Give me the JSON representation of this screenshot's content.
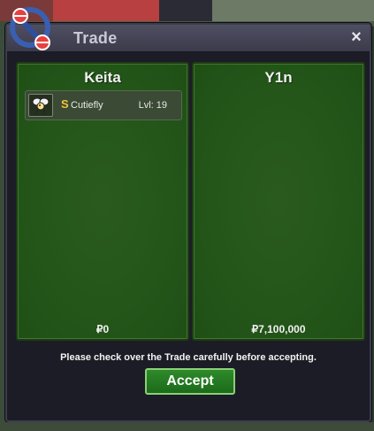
{
  "window": {
    "title": "Trade",
    "close_label": "×"
  },
  "left_panel": {
    "player_name": "Keita",
    "items": [
      {
        "shiny_mark": "S",
        "name": "Cutiefly",
        "level": "Lvl: 19",
        "icon": "cutiefly-sprite-icon"
      }
    ],
    "money": "₽0"
  },
  "right_panel": {
    "player_name": "Y1n",
    "money": "₽7,100,000"
  },
  "notice": "Please check over the Trade carefully before accepting.",
  "accept_label": "Accept",
  "colors": {
    "panel_green": "#24561a",
    "accept_green": "#2e8a2a",
    "shiny_gold": "#f2c23a",
    "window_bg": "#1c1c26"
  }
}
